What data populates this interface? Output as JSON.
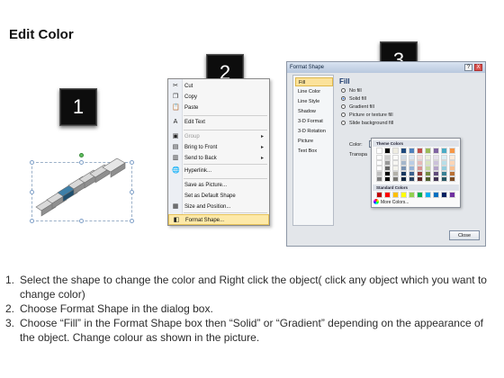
{
  "page": {
    "title": "Edit Color"
  },
  "badges": [
    "1",
    "2",
    "3"
  ],
  "context_menu": {
    "items": [
      {
        "icon": "scissors-icon",
        "glyph": "✂",
        "label": "Cut",
        "submenu": false,
        "disabled": false,
        "highlighted": false
      },
      {
        "icon": "copy-icon",
        "glyph": "❐",
        "label": "Copy",
        "submenu": false,
        "disabled": false,
        "highlighted": false
      },
      {
        "icon": "paste-icon",
        "glyph": "📋",
        "label": "Paste",
        "submenu": false,
        "disabled": false,
        "highlighted": false
      },
      {
        "icon": "edit-text-icon",
        "glyph": "A",
        "label": "Edit Text",
        "submenu": false,
        "disabled": false,
        "highlighted": false
      },
      {
        "icon": "group-icon",
        "glyph": "▣",
        "label": "Group",
        "submenu": true,
        "disabled": true,
        "highlighted": false
      },
      {
        "icon": "bring-to-front-icon",
        "glyph": "▤",
        "label": "Bring to Front",
        "submenu": true,
        "disabled": false,
        "highlighted": false
      },
      {
        "icon": "send-to-back-icon",
        "glyph": "▥",
        "label": "Send to Back",
        "submenu": true,
        "disabled": false,
        "highlighted": false
      },
      {
        "icon": "hyperlink-icon",
        "glyph": "🌐",
        "label": "Hyperlink...",
        "submenu": false,
        "disabled": false,
        "highlighted": false
      },
      {
        "icon": "save-picture-icon",
        "glyph": "",
        "label": "Save as Picture...",
        "submenu": false,
        "disabled": false,
        "highlighted": false
      },
      {
        "icon": "default-shape-icon",
        "glyph": "",
        "label": "Set as Default Shape",
        "submenu": false,
        "disabled": false,
        "highlighted": false
      },
      {
        "icon": "size-position-icon",
        "glyph": "▦",
        "label": "Size and Position...",
        "submenu": false,
        "disabled": false,
        "highlighted": false
      },
      {
        "icon": "format-shape-icon",
        "glyph": "◧",
        "label": "Format Shape...",
        "submenu": false,
        "disabled": false,
        "highlighted": true
      }
    ]
  },
  "dialog": {
    "title": "Format Shape",
    "help_button": "?",
    "close_button_glyph": "X",
    "nav": [
      "Fill",
      "Line Color",
      "Line Style",
      "Shadow",
      "3-D Format",
      "3-D Rotation",
      "Picture",
      "Text Box"
    ],
    "active_nav": "Fill",
    "section_title": "Fill",
    "options": [
      {
        "label": "No fill",
        "selected": false
      },
      {
        "label": "Solid fill",
        "selected": true
      },
      {
        "label": "Gradient fill",
        "selected": false
      },
      {
        "label": "Picture or texture fill",
        "selected": false
      },
      {
        "label": "Slide background fill",
        "selected": false
      }
    ],
    "color_label": "Color:",
    "transparency_label": "Transpa",
    "close_label": "Close"
  },
  "palette": {
    "theme_label": "Theme Colors",
    "standard_label": "Standard Colors",
    "more_label": "More Colors...",
    "theme_colors": [
      "#ffffff",
      "#000000",
      "#eeece1",
      "#1f497d",
      "#4f81bd",
      "#c0504d",
      "#9bbb59",
      "#8064a2",
      "#4bacc6",
      "#f79646"
    ],
    "standard_colors": [
      "#c00000",
      "#ff0000",
      "#ffc000",
      "#ffff00",
      "#92d050",
      "#00b050",
      "#00b0f0",
      "#0070c0",
      "#002060",
      "#7030a0"
    ]
  },
  "steps": [
    {
      "num": "1.",
      "text": "Select the shape to change the color and Right click the object( click any object which you want to change color)"
    },
    {
      "num": "2.",
      "text": "Choose Format Shape in the dialog box."
    },
    {
      "num": "3.",
      "text": "Choose “Fill” in the Format Shape box then “Solid” or “Gradient” depending on the appearance of the object. Change colour as shown in the picture."
    }
  ]
}
